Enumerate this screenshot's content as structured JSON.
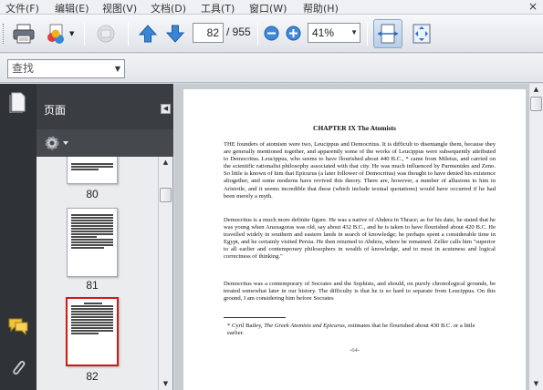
{
  "menu": {
    "items": [
      "文件(F)",
      "编辑(E)",
      "视图(V)",
      "文档(D)",
      "工具(T)",
      "窗口(W)",
      "帮助(H)"
    ],
    "close_label": "×"
  },
  "toolbar": {
    "current_page": "82",
    "total_pages": "/ 955",
    "zoom": "41%"
  },
  "find": {
    "placeholder": "查找"
  },
  "panel": {
    "title": "页面",
    "thumbnails": [
      {
        "label": "80"
      },
      {
        "label": "81"
      },
      {
        "label": "82",
        "selected": true
      }
    ]
  },
  "document": {
    "chapter_title": "CHAPTER IX The Atomists",
    "paragraphs": [
      "THE founders of atomism were two, Leucippus and Democritus. It is difficult to disentangle them, because they are generally mentioned together, and apparently some of the works of Leucippus were subsequently attributed to Democritus. Leucippus, who seems to have flourished about 440 B.C., * came from Miletus, and carried on the scientific rationalist philosophy associated with that city. He was much influenced by Parmenides and Zeno. So little is known of him that Epicurus (a later follower of Democritus) was thought to have denied his existence altogether, and some moderns have revived this theory. There are, however, a number of allusions to him in Aristotle, and it seems incredible that these (which include textual quotations) would have occurred if he had been merely a myth.",
      "Democritus is a much more definite figure. He was a native of Abdera in Thrace; as for his date, he stated that he was young when Anaxagoras was old, say about 432 B.C., and he is taken to have flourished about 420 B.C. He travelled widely in southern and eastern lands in search of knowledge; he perhaps spent a considerable time in Egypt, and he certainly visited Persia. He then returned to Abdera, where he remained. Zeller calls him \"superior to all earlier and contemporary philosophers in wealth of knowledge, and to most in acuteness and logical correctness of thinking.\"",
      "Democritus was a contemporary of Socrates and the Sophists, and should, on purely chronological grounds, be treated somewhat later in our history. The difficulty is that he is so hard to separate from Leucippus. On this ground, I am considering him before Socrates"
    ],
    "footnote_prefix": "*   Cyril Bailey, ",
    "footnote_title": "The Greek Atomists and Epicurus",
    "footnote_suffix": ", estimates that he flourished about 430 B.C. or a little earlier.",
    "page_number": "-64-"
  },
  "colors": {
    "accent_blue": "#2f6fc4",
    "selection_red": "#d21818",
    "nav_dark": "#2f3236"
  }
}
